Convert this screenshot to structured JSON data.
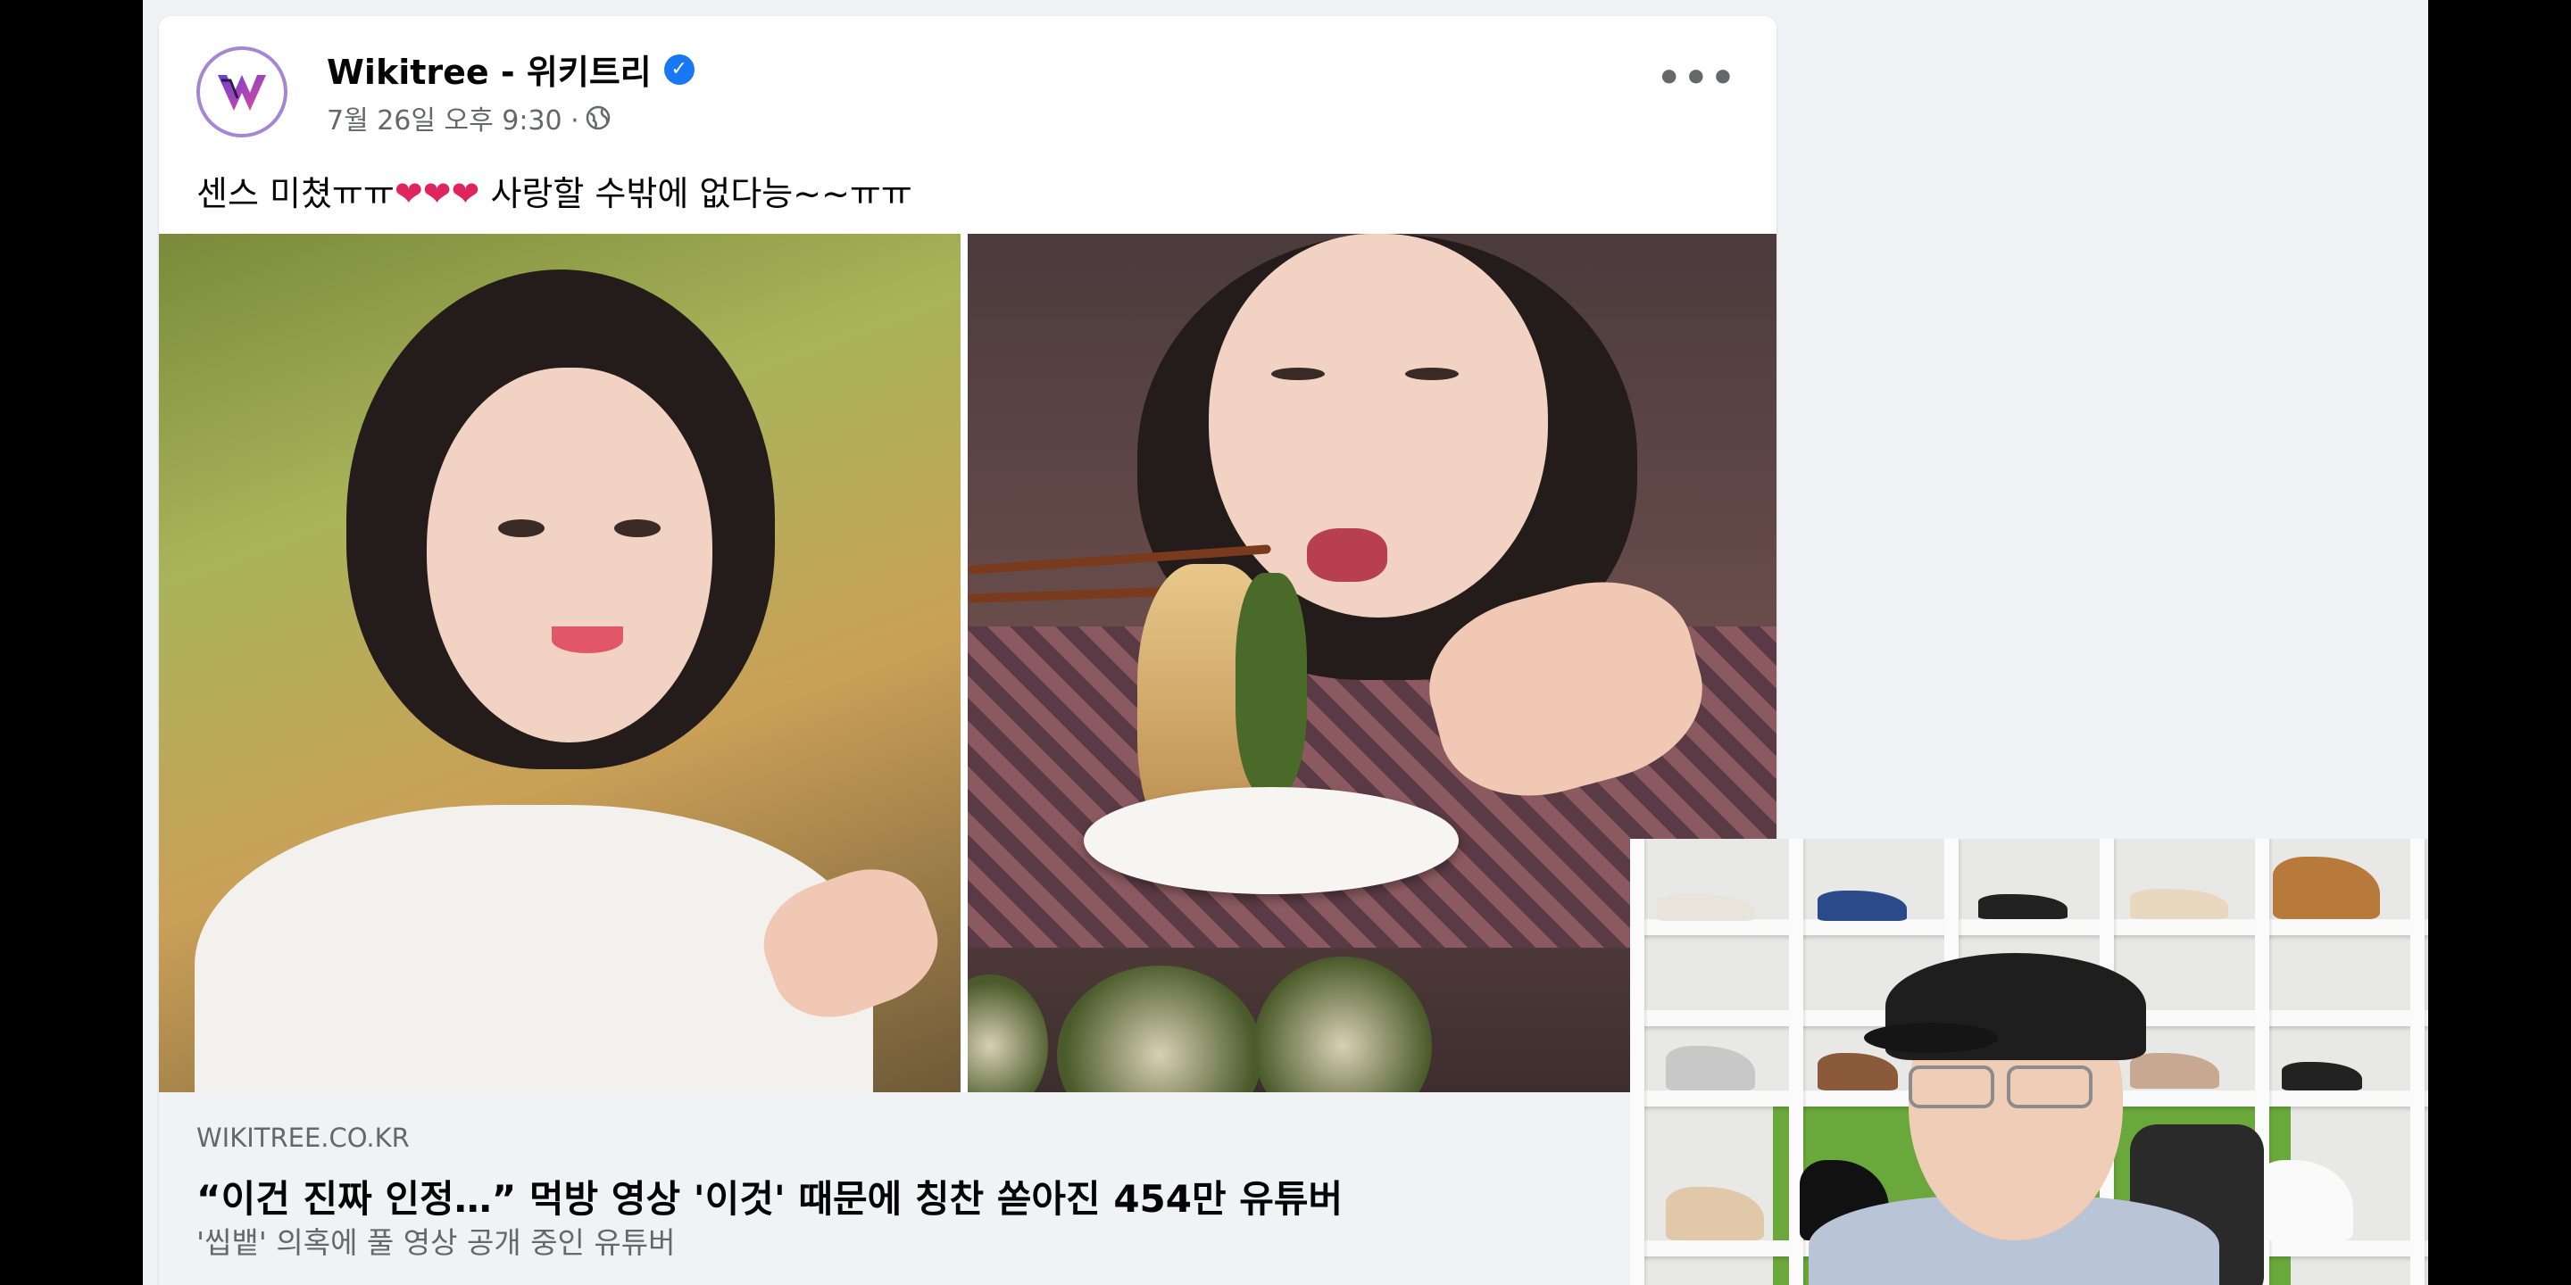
{
  "post": {
    "page_name": "Wikitree - 위키트리",
    "verified_icon": "verified-check-icon",
    "timestamp": "7월 26일 오후 9:30 ·",
    "audience_icon": "globe-icon",
    "more_icon": "more-options-icon",
    "more_label": "•••",
    "caption": {
      "before": "센스 미쳤ㅠㅠ",
      "hearts": "❤❤❤",
      "after": " 사랑할 수밖에 없다능~~ㅠㅠ"
    },
    "link_preview": {
      "domain": "WIKITREE.CO.KR",
      "headline": "“이건 진짜 인정…” 먹방 영상 '이것' 때문에 칭찬 쏟아진 454만 유튜버",
      "subtitle": "'씹뱉' 의혹에 풀 영상 공개 중인 유튜버"
    }
  },
  "colors": {
    "background": "#f0f2f5",
    "card": "#ffffff",
    "text_primary": "#050505",
    "text_secondary": "#65676b",
    "verified": "#1877f2",
    "heart": "#e0245e"
  }
}
